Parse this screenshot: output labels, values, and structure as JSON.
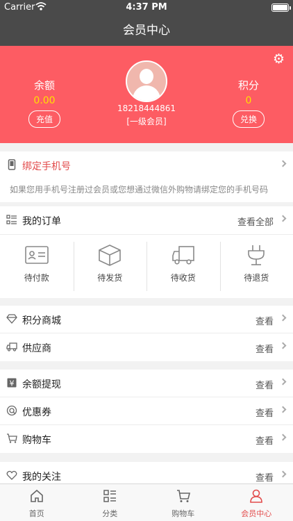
{
  "status": {
    "carrier": "Carrier",
    "time": "4:37 PM"
  },
  "nav": {
    "title": "会员中心"
  },
  "profile": {
    "balance_label": "余额",
    "balance_value": "0.00",
    "recharge_label": "充值",
    "points_label": "积分",
    "points_value": "0",
    "exchange_label": "兑换",
    "user_id": "18218444861",
    "level": "[一级会员]"
  },
  "bind": {
    "title": "绑定手机号",
    "hint": "如果您用手机号注册过会员或您想通过微信外购物请绑定您的手机号码"
  },
  "orders": {
    "title": "我的订单",
    "view_all": "查看全部",
    "items": [
      {
        "label": "待付款",
        "icon": "wallet-icon"
      },
      {
        "label": "待发货",
        "icon": "box-icon"
      },
      {
        "label": "待收货",
        "icon": "truck-icon"
      },
      {
        "label": "待退货",
        "icon": "plug-icon"
      }
    ]
  },
  "menu": [
    {
      "label": "积分商城",
      "right": "查看",
      "icon": "diamond-icon"
    },
    {
      "label": "供应商",
      "right": "查看",
      "icon": "supplier-truck-icon"
    },
    {
      "label": "余额提现",
      "right": "查看",
      "icon": "yen-icon"
    },
    {
      "label": "优惠券",
      "right": "查看",
      "icon": "coupon-icon"
    },
    {
      "label": "购物车",
      "right": "查看",
      "icon": "cart-icon"
    },
    {
      "label": "我的关注",
      "right": "查看",
      "icon": "heart-icon"
    }
  ],
  "tabs": [
    {
      "label": "首页",
      "icon": "home-icon"
    },
    {
      "label": "分类",
      "icon": "category-icon"
    },
    {
      "label": "购物车",
      "icon": "cart-icon"
    },
    {
      "label": "会员中心",
      "icon": "user-icon"
    }
  ],
  "colors": {
    "header": "#4a4a4a",
    "profile_bg": "#fd5c63",
    "accent": "#e24b4b",
    "value": "#ffe000"
  }
}
